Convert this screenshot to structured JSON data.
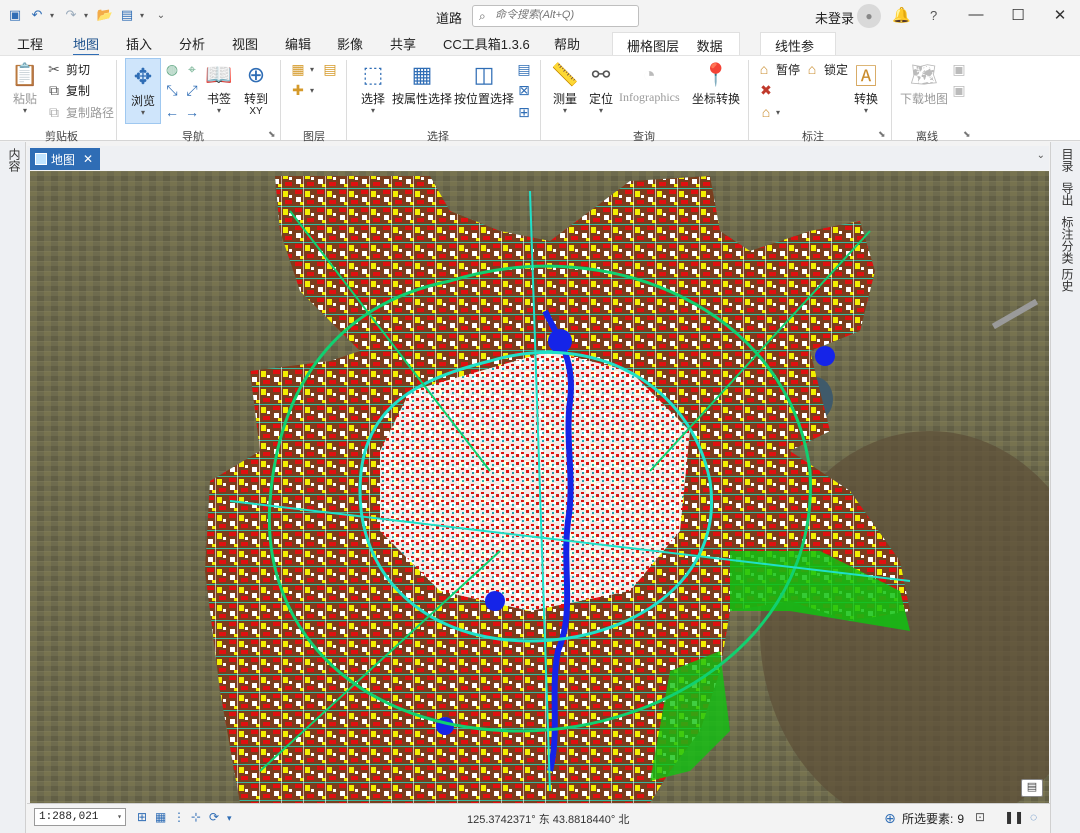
{
  "window": {
    "title": "道路",
    "search_placeholder": "命令搜索(Alt+Q)",
    "login": "未登录",
    "help": "?"
  },
  "tabs": [
    "工程",
    "地图",
    "插入",
    "分析",
    "视图",
    "编辑",
    "影像",
    "共享",
    "CC工具箱1.3.6",
    "帮助"
  ],
  "active_tab": "地图",
  "context_tabs": [
    "栅格图层",
    "数据",
    "线性参考"
  ],
  "ribbon": {
    "clipboard": {
      "paste": "粘贴",
      "cut": "剪切",
      "copy": "复制",
      "copy_path": "复制路径",
      "label": "剪贴板"
    },
    "navigate": {
      "explore": "浏览",
      "bookmarks": "书签",
      "goto_xy": "转到",
      "goto_xy_sub": "XY",
      "label": "导航"
    },
    "layer": {
      "label": "图层"
    },
    "selection": {
      "select": "选择",
      "by_attr": "按属性选择",
      "by_loc": "按位置选择",
      "label": "选择"
    },
    "inquiry": {
      "measure": "测量",
      "locate": "定位",
      "infographics": "Infographics",
      "convert_coords": "坐标转换",
      "label": "查询"
    },
    "labeling": {
      "pause": "暂停",
      "lock": "锁定",
      "convert": "转换",
      "label": "标注"
    },
    "offline": {
      "download_map": "下载地图",
      "label": "离线"
    }
  },
  "doc_tab": {
    "label": "地图"
  },
  "left_strip": [
    "内容"
  ],
  "right_strip": [
    "目录",
    "导出",
    "标注分类",
    "历史"
  ],
  "status": {
    "scale": "1:288,021",
    "coords": "125.3742371° 东 43.8818440° 北",
    "selected_label": "所选要素:",
    "selected_count": "9"
  },
  "colors": {
    "accent": "#2f6db5",
    "map_base": "#6b6a4e",
    "urban_brown": "#7a3e1e",
    "buildings_red": "#e01010",
    "landuse_yellow": "#f2ee00",
    "greenspace": "#11c211",
    "water_blue": "#1524e8",
    "roads_cyan": "#20e0c8"
  }
}
